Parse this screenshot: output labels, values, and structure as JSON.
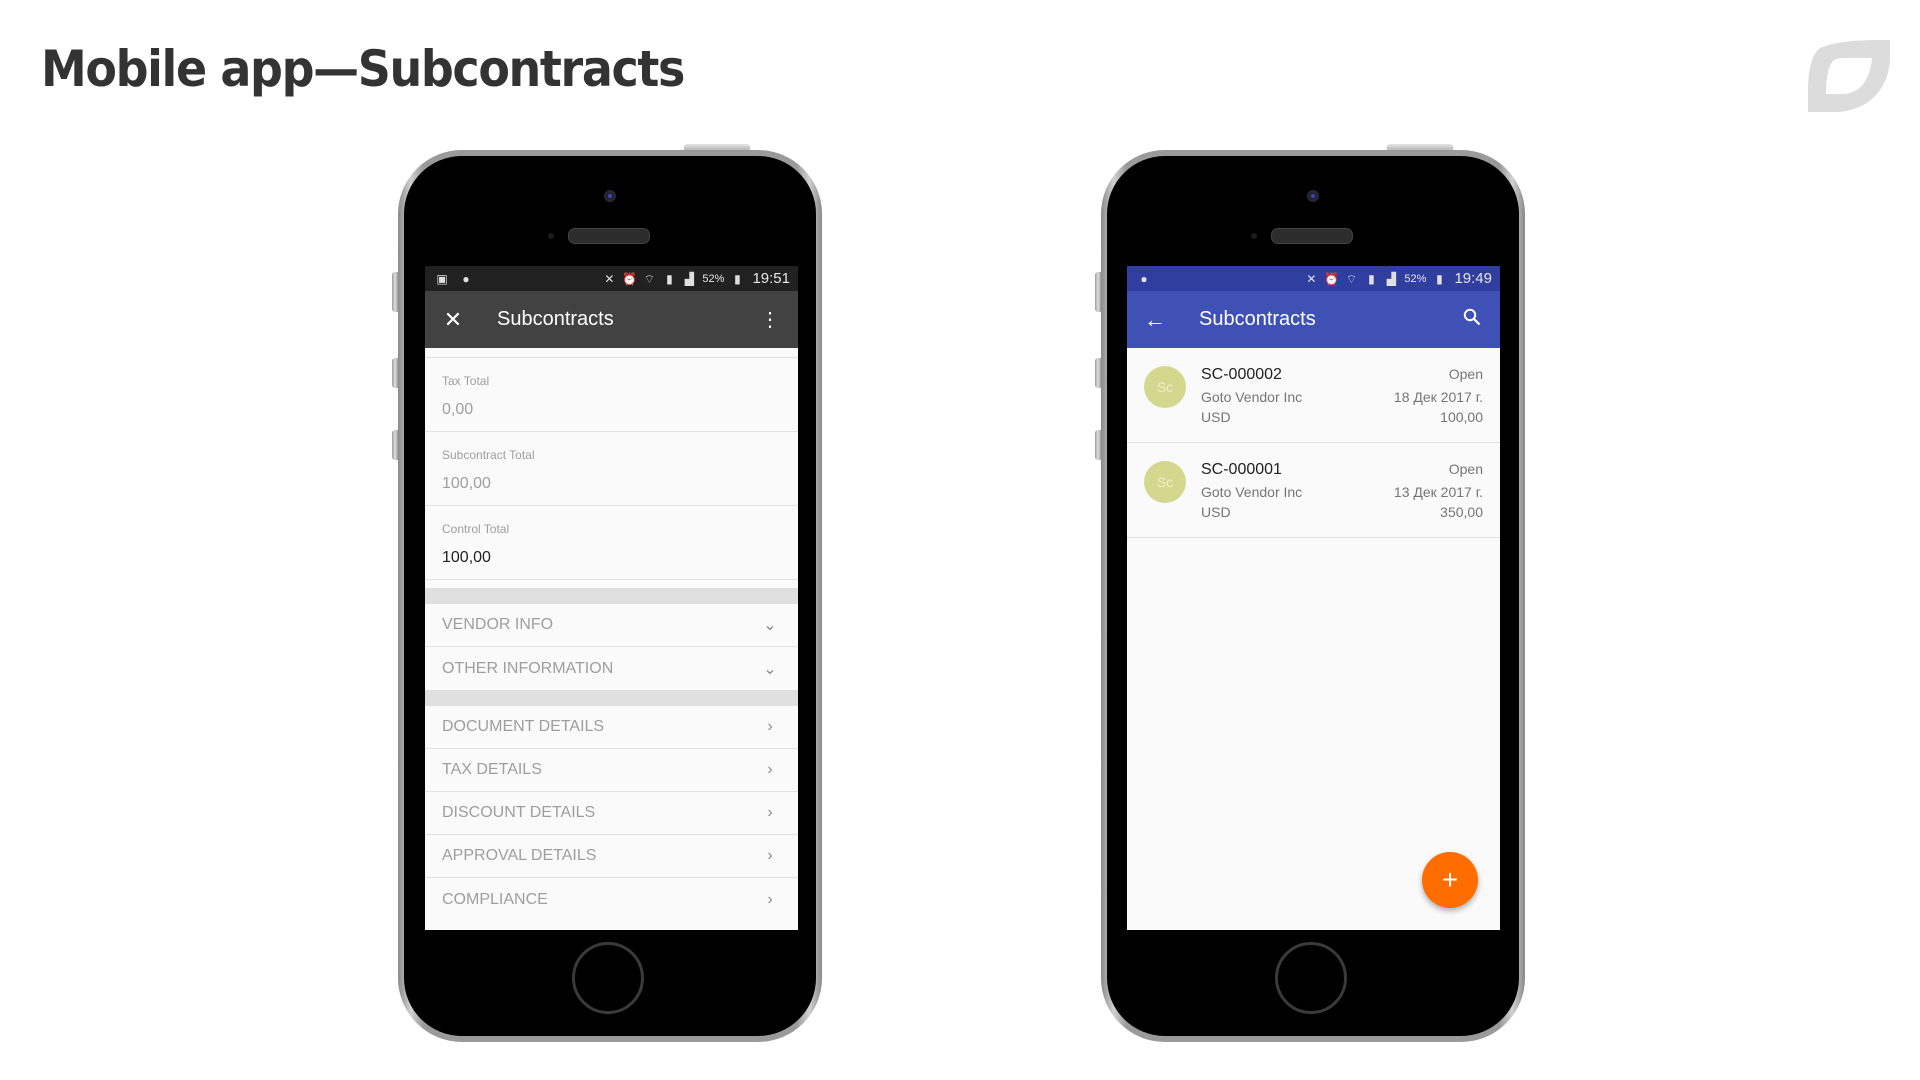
{
  "slide": {
    "title": "Mobile app—Subcontracts",
    "logo_icon": "brand-logo-icon"
  },
  "left_phone": {
    "status_bar": {
      "left_icons": [
        "gallery-icon",
        "app-badge-icon"
      ],
      "right_icons": [
        "mute-icon",
        "alarm-icon",
        "wifi-icon",
        "sim-icon",
        "signal-icon"
      ],
      "battery": "52%",
      "time": "19:51"
    },
    "app_bar": {
      "nav_icon": "close-icon",
      "nav_glyph": "✕",
      "title": "Subcontracts",
      "action_icon": "more-vert-icon",
      "action_glyph": "⋮"
    },
    "fields": [
      {
        "label": "Tax Total",
        "value": "0,00",
        "editable": false
      },
      {
        "label": "Subcontract Total",
        "value": "100,00",
        "editable": false
      },
      {
        "label": "Control Total",
        "value": "100,00",
        "editable": true
      }
    ],
    "expandable_sections": [
      {
        "label": "VENDOR INFO",
        "icon": "chevron-down-icon",
        "glyph": "⌄"
      },
      {
        "label": "OTHER INFORMATION",
        "icon": "chevron-down-icon",
        "glyph": "⌄"
      }
    ],
    "nav_sections": [
      {
        "label": "DOCUMENT DETAILS",
        "icon": "chevron-right-icon",
        "glyph": "›"
      },
      {
        "label": "TAX DETAILS",
        "icon": "chevron-right-icon",
        "glyph": "›"
      },
      {
        "label": "DISCOUNT DETAILS",
        "icon": "chevron-right-icon",
        "glyph": "›"
      },
      {
        "label": "APPROVAL DETAILS",
        "icon": "chevron-right-icon",
        "glyph": "›"
      },
      {
        "label": "COMPLIANCE",
        "icon": "chevron-right-icon",
        "glyph": "›"
      }
    ],
    "colors": {
      "status_bar": "#212121",
      "app_bar": "#424242"
    }
  },
  "right_phone": {
    "status_bar": {
      "left_icons": [
        "app-badge-icon"
      ],
      "right_icons": [
        "mute-icon",
        "alarm-icon",
        "wifi-icon",
        "sim-icon",
        "signal-icon"
      ],
      "battery": "52%",
      "time": "19:49"
    },
    "app_bar": {
      "nav_icon": "back-arrow-icon",
      "nav_glyph": "←",
      "title": "Subcontracts",
      "action_icon": "search-icon"
    },
    "items": [
      {
        "avatar": "Sc",
        "id": "SC-000002",
        "vendor": "Goto Vendor Inc",
        "currency": "USD",
        "status": "Open",
        "date": "18 Дек 2017 г.",
        "amount": "100,00"
      },
      {
        "avatar": "Sc",
        "id": "SC-000001",
        "vendor": "Goto Vendor Inc",
        "currency": "USD",
        "status": "Open",
        "date": "13 Дек 2017 г.",
        "amount": "350,00"
      }
    ],
    "fab": {
      "icon": "add-icon",
      "glyph": "+"
    },
    "colors": {
      "status_bar": "#303f9f",
      "app_bar": "#3f51b5",
      "fab": "#ff6d00",
      "avatar": "#d4d88f"
    }
  }
}
